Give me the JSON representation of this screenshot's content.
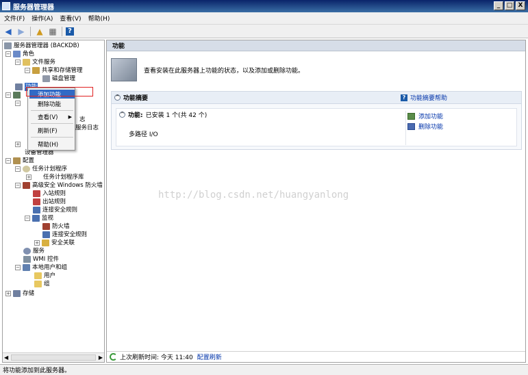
{
  "window": {
    "title": "服务器管理器",
    "btn_min": "_",
    "btn_max": "□",
    "btn_close": "X"
  },
  "menu": [
    "文件(F)",
    "操作(A)",
    "查看(V)",
    "帮助(H)"
  ],
  "toolbar": {
    "back_icon": "back-arrow-icon",
    "forward_icon": "forward-arrow-icon",
    "help_label": "?"
  },
  "tree": {
    "root": "服务器管理器 (BACKDB)",
    "roles": "角色",
    "file_services": "文件服务",
    "share_storage": "共享和存储管理",
    "disk_mgmt": "磁盘管理",
    "features": "功能",
    "diag_partial_1": "志",
    "diag_partial_2": "服务日志",
    "device_mgr": "设备管理器",
    "config": "配置",
    "task_scheduler": "任务计划程序",
    "task_library": "任务计划程序库",
    "firewall": "高级安全 Windows 防火墙",
    "inbound": "入站规则",
    "outbound": "出站规则",
    "conn_security": "连接安全规则",
    "monitor": "监视",
    "fw": "防火墙",
    "conn_security_2": "连接安全规则",
    "security_assoc": "安全关联",
    "services": "服务",
    "wmi": "WMI 控件",
    "local_users": "本地用户和组",
    "users": "用户",
    "groups": "组",
    "storage": "存储",
    "exp_plus": "+",
    "exp_minus": "−"
  },
  "context_menu": {
    "items": [
      "添加功能",
      "删除功能",
      "查看(V)",
      "刷新(F)",
      "帮助(H)"
    ],
    "submenu_arrow": "▶"
  },
  "right": {
    "header": "功能",
    "intro": "查看安装在此服务器上功能的状态，以及添加或删除功能。",
    "summary_title": "功能摘要",
    "summary_help": "功能摘要帮助",
    "features_label": "功能:",
    "features_value": "已安装 1 个(共 42 个)",
    "installed_feature": "多路径 I/O",
    "action_add": "添加功能",
    "action_remove": "删除功能",
    "collapse_glyph": "^",
    "refresh_label": "上次刷新时间: 今天 11:40",
    "refresh_link": "配置刷新"
  },
  "watermark": "http://blog.csdn.net/huangyanlong",
  "statusbar": "将功能添加到此服务器。",
  "scroll": {
    "left": "◀",
    "right": "▶"
  }
}
